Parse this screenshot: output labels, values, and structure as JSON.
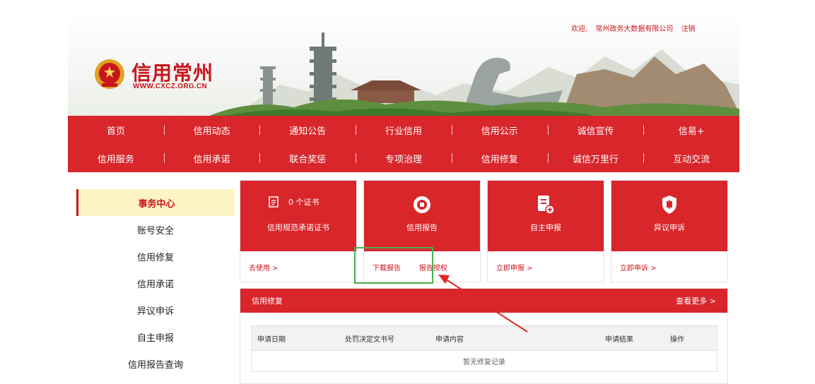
{
  "header": {
    "logo_title": "信用常州",
    "logo_url": "WWW.CXCZ.ORG.CN",
    "welcome": "欢迎,",
    "company": "常州政务大数据有限公司",
    "logout": "注销"
  },
  "nav": {
    "row1": [
      "首页",
      "信用动态",
      "通知公告",
      "行业信用",
      "信用公示",
      "诚信宣传",
      "信易+"
    ],
    "row2": [
      "信用服务",
      "信用承诺",
      "联合奖惩",
      "专项治理",
      "信用修复",
      "诚信万里行",
      "互动交流"
    ]
  },
  "sidebar": {
    "items": [
      {
        "label": "事务中心"
      },
      {
        "label": "账号安全"
      },
      {
        "label": "信用修复"
      },
      {
        "label": "信用承诺"
      },
      {
        "label": "异议申诉"
      },
      {
        "label": "自主申报"
      },
      {
        "label": "信用报告查询"
      }
    ]
  },
  "cards": {
    "cert": {
      "count": "0 个证书",
      "title": "信用规范承诺证书",
      "link": "去使用 >"
    },
    "report": {
      "title": "信用报告",
      "download": "下载报告",
      "auth": "报告授权"
    },
    "declare": {
      "title": "自主申报",
      "link": "立即申报 >"
    },
    "appeal": {
      "title": "异议申诉",
      "link": "立即申诉 >"
    }
  },
  "panel": {
    "title": "信用修复",
    "more": "查看更多 >",
    "columns": [
      "申请日期",
      "处罚决定文书号",
      "申请内容",
      "申请结果",
      "操作"
    ],
    "empty": "暂无修复记录"
  },
  "colors": {
    "brand_red": "#d8262b",
    "active_bg": "#fdf3c4",
    "highlight": "#4caf50",
    "arrow": "#e0261f"
  }
}
